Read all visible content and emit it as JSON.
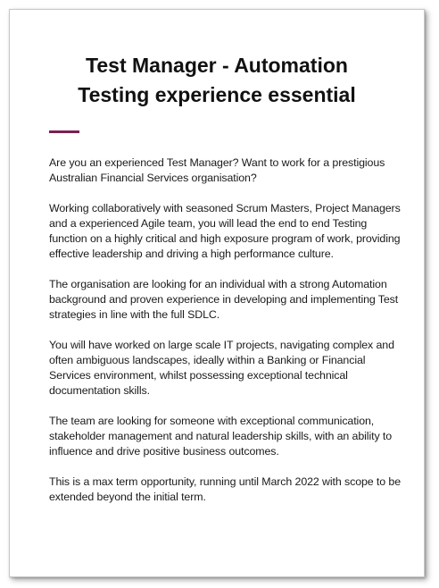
{
  "document": {
    "title_line_1": "Test Manager - Automation",
    "title_line_2": "Testing experience essential",
    "accent_color": "#7a2150",
    "paragraphs": [
      "Are you an experienced Test Manager? Want to work for a prestigious Australian Financial Services organisation?",
      "Working collaboratively with seasoned Scrum Masters, Project Managers and a experienced Agile team, you will lead the end to end Testing function on a highly critical and high exposure program of work, providing effective leadership and driving a high performance culture.",
      "The organisation are looking for an individual with a strong Automation background and proven experience in developing and implementing Test strategies in line with the full SDLC.",
      "You will have worked on large scale IT projects, navigating complex and often ambiguous landscapes, ideally within a Banking or Financial Services environment, whilst possessing exceptional technical documentation skills.",
      "The team are looking for someone with exceptional communication, stakeholder management and natural leadership skills, with an ability to influence and drive positive business outcomes.",
      "This is a max term opportunity, running until March 2022 with scope to be extended beyond the initial term."
    ]
  }
}
